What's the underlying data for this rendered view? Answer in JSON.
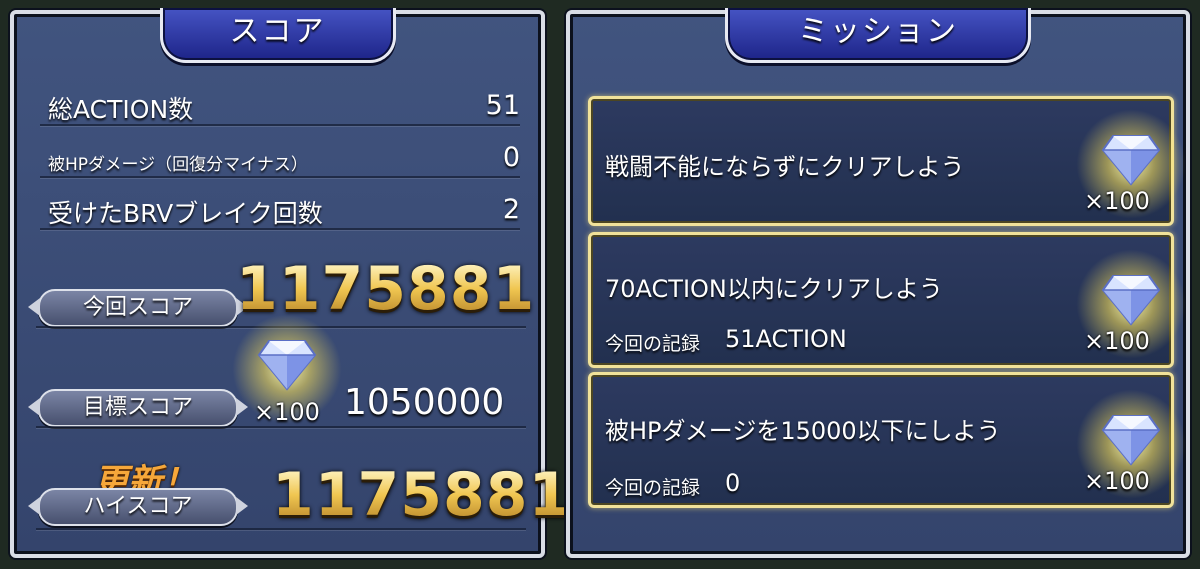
{
  "score_panel": {
    "title": "スコア",
    "stats": [
      {
        "label": "総ACTION数",
        "value": "51"
      },
      {
        "label": "被HPダメージ（回復分マイナス）",
        "value": "0"
      },
      {
        "label": "受けたBRVブレイク回数",
        "value": "2"
      }
    ],
    "current_score_label": "今回スコア",
    "current_score": "1175881",
    "target_score_label": "目標スコア",
    "target_reward_qty": "×100",
    "target_score": "1050000",
    "update_label": "更新！",
    "high_score_label": "ハイスコア",
    "high_score": "1175881"
  },
  "mission_panel": {
    "title": "ミッション",
    "missions": [
      {
        "title": "戦闘不能にならずにクリアしよう",
        "record_label": "",
        "record_value": "",
        "reward_qty": "×100"
      },
      {
        "title": "70ACTION以内にクリアしよう",
        "record_label": "今回の記録",
        "record_value": "51ACTION",
        "reward_qty": "×100"
      },
      {
        "title": "被HPダメージを15000以下にしよう",
        "record_label": "今回の記録",
        "record_value": "0",
        "reward_qty": "×100"
      }
    ]
  },
  "icons": {
    "reward": "diamond-gem-icon"
  },
  "colors": {
    "gold": "#f0c651",
    "tab_blue": "#2a34a8",
    "mission_border": "#f1e29a",
    "update_orange": "#f6a73a"
  }
}
